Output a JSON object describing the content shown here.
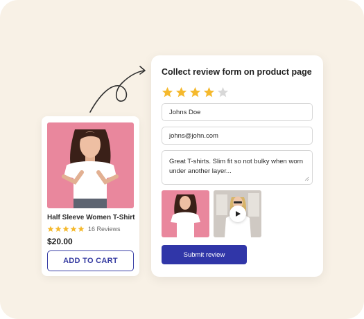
{
  "colors": {
    "background": "#f8f1e6",
    "star_filled": "#f5b92d",
    "star_empty": "#d8d8d8",
    "accent": "#3036a8",
    "product_image_bg": "#e9879d"
  },
  "product": {
    "title": "Half Sleeve Women T-Shirt",
    "rating": 5,
    "review_count": "16 Reviews",
    "price": "$20.00",
    "cart_button": "ADD TO CART"
  },
  "review_form": {
    "title": "Collect review form on product page",
    "rating": 4,
    "rating_max": 5,
    "name_value": "Johns Doe",
    "email_value": "johns@john.com",
    "review_text": "Great T-shirts. Slim fit so not bulky when worn under another layer...",
    "media": [
      {
        "type": "image",
        "icon": "photo-thumbnail"
      },
      {
        "type": "video",
        "icon": "play-icon"
      }
    ],
    "submit_label": "Submit review"
  }
}
